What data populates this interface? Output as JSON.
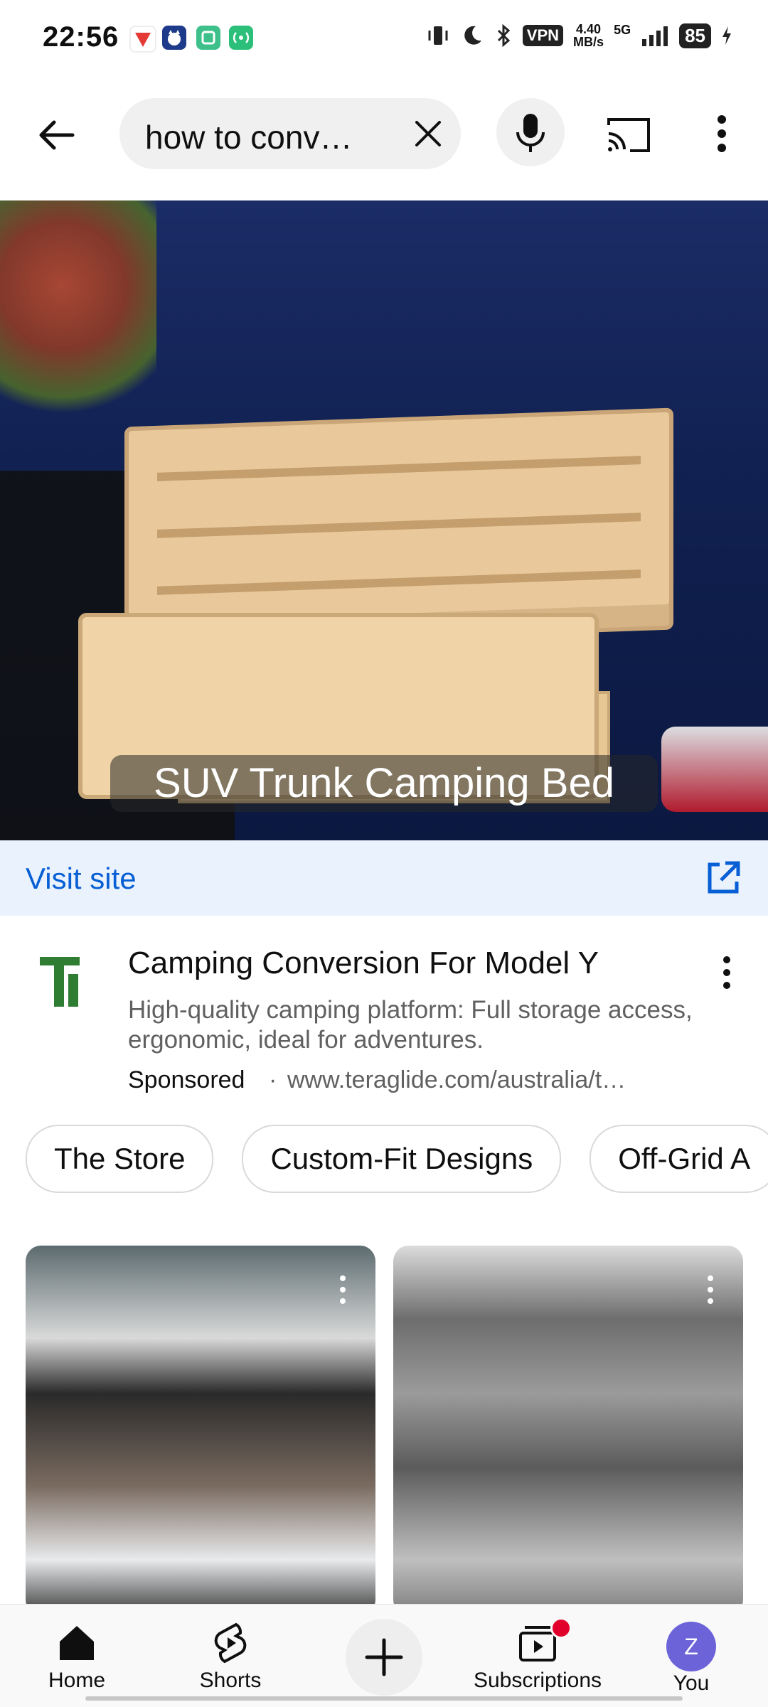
{
  "status_bar": {
    "time": "22:56",
    "vpn": "VPN",
    "speed_value": "4.40",
    "speed_unit": "MB/s",
    "network": "5G",
    "battery": "85"
  },
  "search": {
    "query": "how to conv…"
  },
  "hero": {
    "caption": "SUV Trunk Camping Bed"
  },
  "visit": {
    "label": "Visit site"
  },
  "ad": {
    "title": "Camping Conversion For Model Y",
    "description": "High-quality camping platform: Full storage access, ergonomic, ideal for adventures.",
    "sponsored": "Sponsored",
    "separator": "·",
    "url": "www.teraglide.com/australia/t…"
  },
  "chips": [
    "The Store",
    "Custom-Fit Designs",
    "Off-Grid A"
  ],
  "nav": {
    "home": "Home",
    "shorts": "Shorts",
    "subscriptions": "Subscriptions",
    "you": "You",
    "avatar_letter": "Z"
  },
  "colors": {
    "accent_blue": "#065fd4",
    "visit_bg": "#eaf2fd",
    "avatar": "#6c63d8",
    "badge_red": "#e0002b",
    "brand_green": "#2e7d32"
  }
}
